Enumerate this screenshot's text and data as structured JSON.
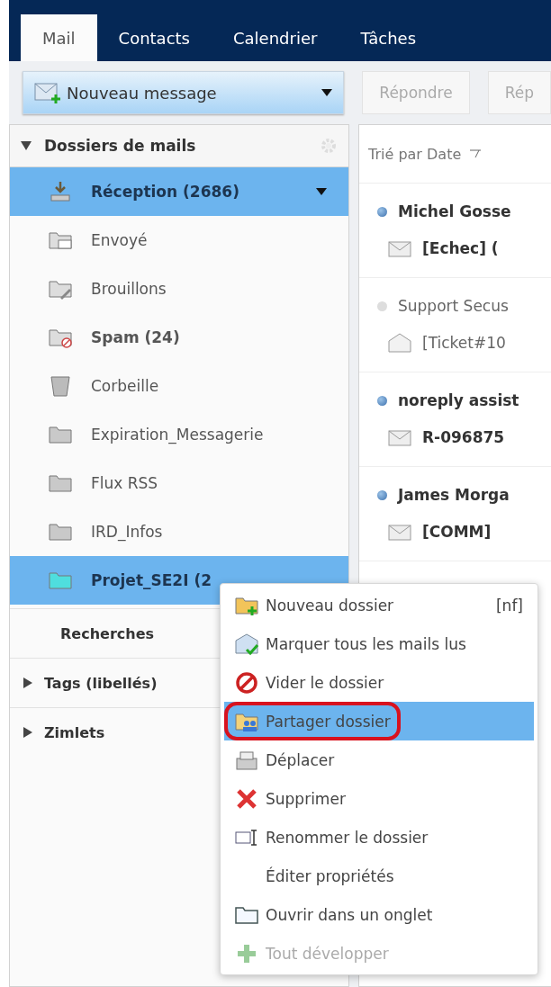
{
  "tabs": [
    {
      "label": "Mail",
      "selected": true
    },
    {
      "label": "Contacts",
      "selected": false
    },
    {
      "label": "Calendrier",
      "selected": false
    },
    {
      "label": "Tâches",
      "selected": false
    }
  ],
  "toolbar": {
    "new_message": "Nouveau message",
    "buttons": [
      "Répondre",
      "Rép"
    ]
  },
  "folders_panel": {
    "title": "Dossiers de mails",
    "expanded": true,
    "folders": [
      {
        "kind": "inbox",
        "label": "Réception (2686)",
        "bold": true,
        "selected": true
      },
      {
        "kind": "sent",
        "label": "Envoyé",
        "bold": false,
        "selected": false
      },
      {
        "kind": "drafts",
        "label": "Brouillons",
        "bold": false,
        "selected": false
      },
      {
        "kind": "spam",
        "label": "Spam (24)",
        "bold": true,
        "selected": false
      },
      {
        "kind": "trash",
        "label": "Corbeille",
        "bold": false,
        "selected": false
      },
      {
        "kind": "folder",
        "label": "Expiration_Messagerie",
        "bold": false,
        "selected": false
      },
      {
        "kind": "folder",
        "label": "Flux RSS",
        "bold": false,
        "selected": false
      },
      {
        "kind": "folder",
        "label": "IRD_Infos",
        "bold": false,
        "selected": false
      },
      {
        "kind": "shared",
        "label": "Projet_SE2I (2",
        "bold": true,
        "selected": true
      }
    ]
  },
  "sections": [
    {
      "label": "Recherches",
      "kind": "plain"
    },
    {
      "label": "Tags (libellés)",
      "kind": "collapsible",
      "expanded": false
    },
    {
      "label": "Zimlets",
      "kind": "collapsible",
      "expanded": false
    }
  ],
  "message_list": {
    "sort": "Trié par Date",
    "messages": [
      {
        "sender": "Michel Gosse",
        "subject": "[Echec] (",
        "unread": true
      },
      {
        "sender": "Support Secus",
        "subject": "[Ticket#10",
        "unread": false
      },
      {
        "sender": "noreply assist",
        "subject": "R-096875",
        "unread": true
      },
      {
        "sender": "James Morga",
        "subject": "[COMM]",
        "unread": true
      }
    ]
  },
  "context_menu": [
    {
      "kind": "new-folder",
      "label": "Nouveau dossier",
      "shortcut": "[nf]",
      "disabled": false,
      "selected": false,
      "circled": false
    },
    {
      "kind": "mark-read",
      "label": "Marquer tous les mails lus",
      "disabled": false,
      "selected": false,
      "circled": false
    },
    {
      "kind": "empty",
      "label": "Vider le dossier",
      "disabled": false,
      "selected": false,
      "circled": false
    },
    {
      "kind": "share",
      "label": "Partager dossier",
      "disabled": false,
      "selected": true,
      "circled": true
    },
    {
      "kind": "move",
      "label": "Déplacer",
      "disabled": false,
      "selected": false,
      "circled": false
    },
    {
      "kind": "delete",
      "label": "Supprimer",
      "disabled": false,
      "selected": false,
      "circled": false
    },
    {
      "kind": "rename",
      "label": "Renommer le dossier",
      "disabled": false,
      "selected": false,
      "circled": false
    },
    {
      "kind": "none",
      "label": "Éditer propriétés",
      "disabled": false,
      "selected": false,
      "circled": false
    },
    {
      "kind": "open-tab",
      "label": "Ouvrir dans un onglet",
      "disabled": false,
      "selected": false,
      "circled": false
    },
    {
      "kind": "expand",
      "label": "Tout développer",
      "disabled": true,
      "selected": false,
      "circled": false
    }
  ]
}
